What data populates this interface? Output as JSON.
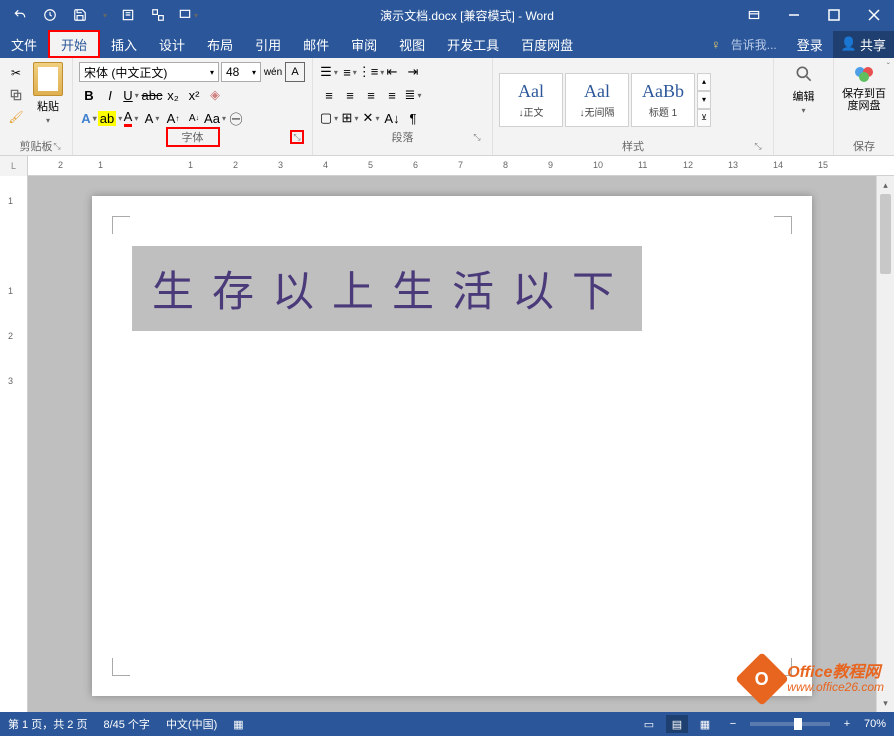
{
  "titlebar": {
    "doc_title": "演示文档.docx [兼容模式] - Word"
  },
  "menu": {
    "file": "文件",
    "home": "开始",
    "insert": "插入",
    "design": "设计",
    "layout": "布局",
    "references": "引用",
    "mailings": "邮件",
    "review": "审阅",
    "view": "视图",
    "developer": "开发工具",
    "baidu": "百度网盘",
    "tell_me": "告诉我...",
    "login": "登录",
    "share": "共享"
  },
  "ribbon": {
    "clipboard": {
      "paste": "粘贴",
      "label": "剪贴板"
    },
    "font": {
      "name": "宋体 (中文正文)",
      "size": "48",
      "label": "字体"
    },
    "paragraph": {
      "label": "段落"
    },
    "styles": {
      "label": "样式",
      "s1_preview": "Aal",
      "s1_name": "↓正文",
      "s2_preview": "Aal",
      "s2_name": "↓无间隔",
      "s3_preview": "AaBb",
      "s3_name": "标题 1"
    },
    "editing": {
      "label": "编辑"
    },
    "save": {
      "btn": "保存到百度网盘",
      "label": "保存"
    }
  },
  "ruler": {
    "marks": [
      "2",
      "1",
      "1",
      "2",
      "3",
      "4",
      "5",
      "6",
      "7",
      "8",
      "9",
      "10",
      "11",
      "12",
      "13",
      "14",
      "15"
    ],
    "vmarks": [
      "1",
      "1",
      "2",
      "3"
    ]
  },
  "document": {
    "selected_text": "生存以上生活以下"
  },
  "statusbar": {
    "page": "第 1 页，共 2 页",
    "words": "8/45 个字",
    "lang": "中文(中国)",
    "zoom": "70%"
  },
  "watermark": {
    "line1": "Office教程网",
    "line2": "www.office26.com"
  }
}
